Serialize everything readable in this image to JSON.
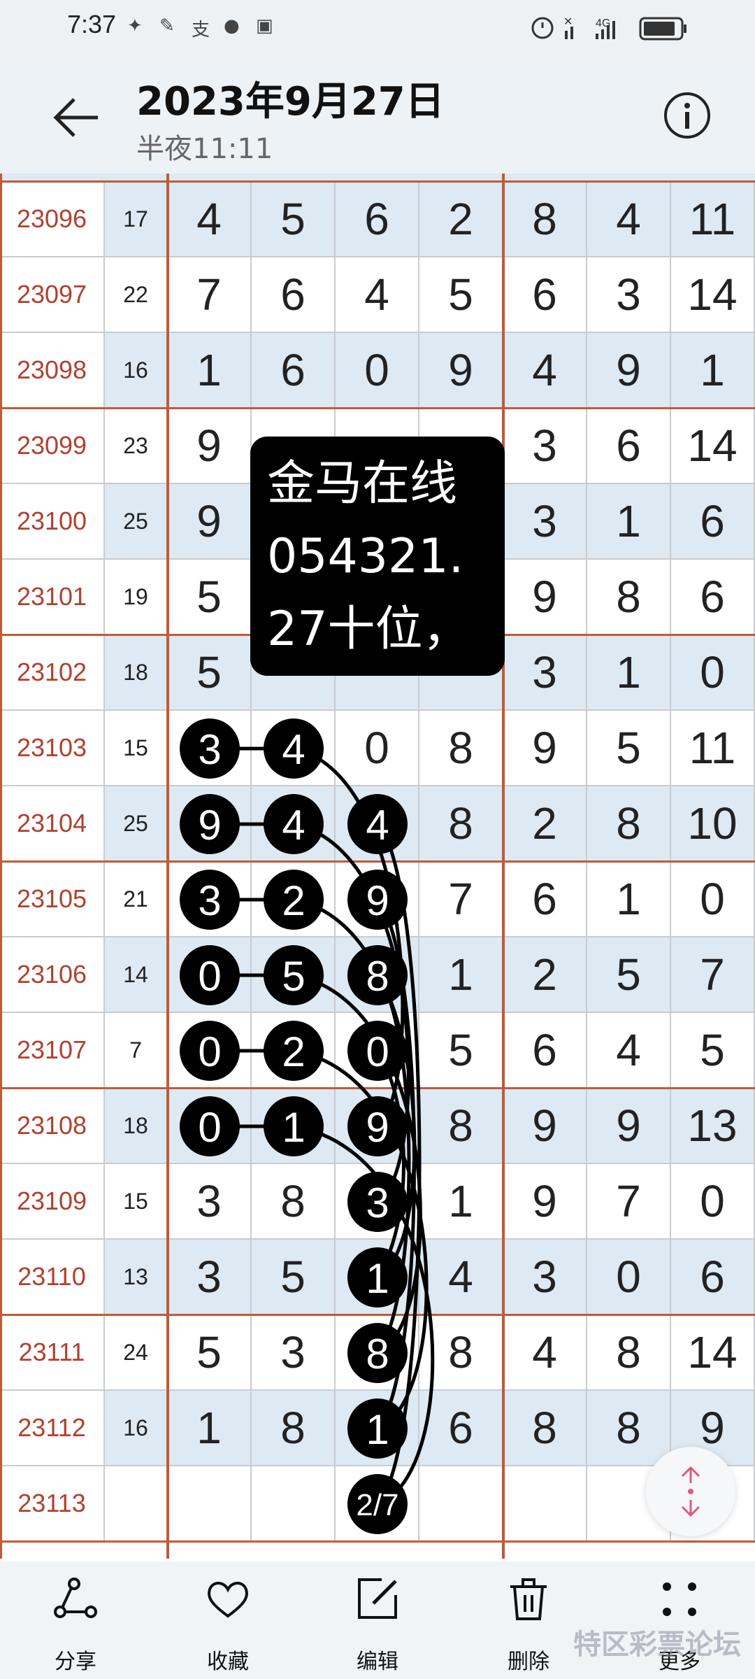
{
  "status_bar": {
    "time": "7:37",
    "app_icons": [
      "✦",
      "✎",
      "支",
      "●",
      "▣"
    ]
  },
  "header": {
    "title": "2023年9月27日",
    "subtitle": "半夜11:11",
    "back_icon": "arrow-left-icon",
    "info_icon": "info-icon"
  },
  "table": {
    "rows": [
      {
        "period": "23096",
        "sum": "17",
        "d": [
          "4",
          "5",
          "6",
          "2",
          "8",
          "4",
          "11"
        ]
      },
      {
        "period": "23097",
        "sum": "22",
        "d": [
          "7",
          "6",
          "4",
          "5",
          "6",
          "3",
          "14"
        ]
      },
      {
        "period": "23098",
        "sum": "16",
        "d": [
          "1",
          "6",
          "0",
          "9",
          "4",
          "9",
          "1"
        ]
      },
      {
        "period": "23099",
        "sum": "23",
        "d": [
          "9",
          "",
          "",
          "",
          "3",
          "6",
          "14"
        ]
      },
      {
        "period": "23100",
        "sum": "25",
        "d": [
          "9",
          "",
          "",
          "",
          "3",
          "1",
          "6"
        ]
      },
      {
        "period": "23101",
        "sum": "19",
        "d": [
          "5",
          "",
          "",
          "",
          "9",
          "8",
          "6"
        ]
      },
      {
        "period": "23102",
        "sum": "18",
        "d": [
          "5",
          "",
          "",
          "",
          "3",
          "1",
          "0"
        ]
      },
      {
        "period": "23103",
        "sum": "15",
        "d": [
          "3",
          "4",
          "0",
          "8",
          "9",
          "5",
          "11"
        ]
      },
      {
        "period": "23104",
        "sum": "25",
        "d": [
          "9",
          "4",
          "4",
          "8",
          "2",
          "8",
          "10"
        ]
      },
      {
        "period": "23105",
        "sum": "21",
        "d": [
          "3",
          "2",
          "9",
          "7",
          "6",
          "1",
          "0"
        ]
      },
      {
        "period": "23106",
        "sum": "14",
        "d": [
          "0",
          "5",
          "8",
          "1",
          "2",
          "5",
          "7"
        ]
      },
      {
        "period": "23107",
        "sum": "7",
        "d": [
          "0",
          "2",
          "0",
          "5",
          "6",
          "4",
          "5"
        ]
      },
      {
        "period": "23108",
        "sum": "18",
        "d": [
          "0",
          "1",
          "9",
          "8",
          "9",
          "9",
          "13"
        ]
      },
      {
        "period": "23109",
        "sum": "15",
        "d": [
          "3",
          "8",
          "3",
          "1",
          "9",
          "7",
          "0"
        ]
      },
      {
        "period": "23110",
        "sum": "13",
        "d": [
          "3",
          "5",
          "1",
          "4",
          "3",
          "0",
          "6"
        ]
      },
      {
        "period": "23111",
        "sum": "24",
        "d": [
          "5",
          "3",
          "8",
          "8",
          "4",
          "8",
          "14"
        ]
      },
      {
        "period": "23112",
        "sum": "16",
        "d": [
          "1",
          "8",
          "1",
          "6",
          "8",
          "8",
          "9"
        ]
      },
      {
        "period": "23113",
        "sum": "",
        "d": [
          "",
          "",
          "",
          "",
          "",
          "",
          ""
        ]
      }
    ],
    "circle_pairs": [
      {
        "row": 7,
        "a": "3",
        "b": "4"
      },
      {
        "row": 8,
        "a": "9",
        "b": "4"
      },
      {
        "row": 9,
        "a": "3",
        "b": "2"
      },
      {
        "row": 10,
        "a": "0",
        "b": "5"
      },
      {
        "row": 11,
        "a": "0",
        "b": "2"
      },
      {
        "row": 12,
        "a": "0",
        "b": "1"
      }
    ],
    "circle_col3": [
      {
        "row": 8,
        "v": "4"
      },
      {
        "row": 9,
        "v": "9"
      },
      {
        "row": 10,
        "v": "8"
      },
      {
        "row": 11,
        "v": "0"
      },
      {
        "row": 12,
        "v": "9"
      },
      {
        "row": 13,
        "v": "3"
      },
      {
        "row": 14,
        "v": "1"
      },
      {
        "row": 15,
        "v": "8"
      },
      {
        "row": 16,
        "v": "1"
      },
      {
        "row": 17,
        "v": "2/7"
      }
    ]
  },
  "note": {
    "lines": [
      "金马在线",
      "054321.",
      "27十位，"
    ]
  },
  "colors": {
    "period_red": "#b0412e",
    "accent_line": "#c25a36",
    "band_blue": "#dde9f3"
  },
  "bottom_bar": [
    {
      "label": "分享",
      "icon": "share-icon"
    },
    {
      "label": "收藏",
      "icon": "heart-icon"
    },
    {
      "label": "编辑",
      "icon": "edit-icon"
    },
    {
      "label": "删除",
      "icon": "trash-icon"
    },
    {
      "label": "更多",
      "icon": "more-icon"
    }
  ],
  "watermark": "特区彩票论坛"
}
